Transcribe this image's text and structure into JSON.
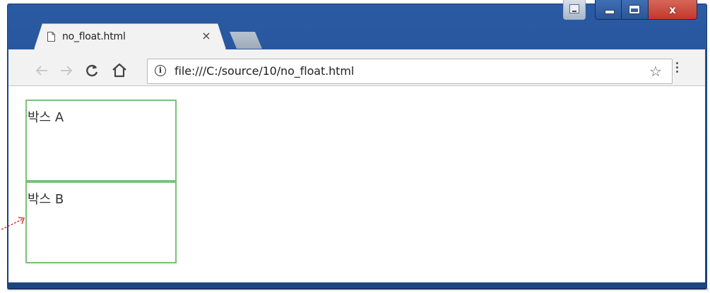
{
  "window": {
    "controls": [
      "minimize",
      "maximize",
      "close"
    ],
    "close_glyph": "x"
  },
  "tab": {
    "title": "no_float.html",
    "close_glyph": "×",
    "icon": "page-icon"
  },
  "toolbar": {
    "back_icon": "back-arrow-icon",
    "forward_icon": "forward-arrow-icon",
    "reload_icon": "reload-icon",
    "home_icon": "home-icon",
    "info_icon": "info-icon",
    "info_glyph": "i",
    "url": "file:///C:/source/10/no_float.html",
    "star_glyph": "☆",
    "menu_icon": "vertical-dots-icon"
  },
  "page": {
    "box_a": "박스 A",
    "box_b": "박스 B"
  },
  "colors": {
    "window_frame": "#23508f",
    "box_border": "#7ec07a",
    "arrow": "#d63a3a"
  }
}
